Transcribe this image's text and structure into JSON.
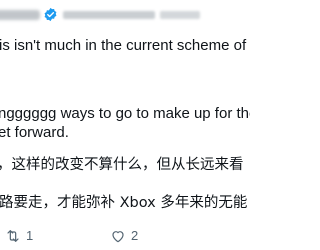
{
  "header": {
    "display_name": "",
    "handle": ""
  },
  "tweet": {
    "lines": [
      "is isn't much in the current scheme of",
      "ngggggg ways to go to make up for the",
      "et forward.",
      "，这样的改变不算什么，但从长远来看",
      "路要走，才能弥补 Xbox 多年来的无能"
    ]
  },
  "actions": {
    "retweet_count": "1",
    "like_count": "2"
  },
  "colors": {
    "text": "#0f1419",
    "muted": "#536471",
    "verified": "#1d9bf0",
    "background": "#ffffff"
  },
  "icons": {
    "verified": "verified-badge-icon",
    "retweet": "retweet-icon",
    "like": "heart-icon"
  }
}
